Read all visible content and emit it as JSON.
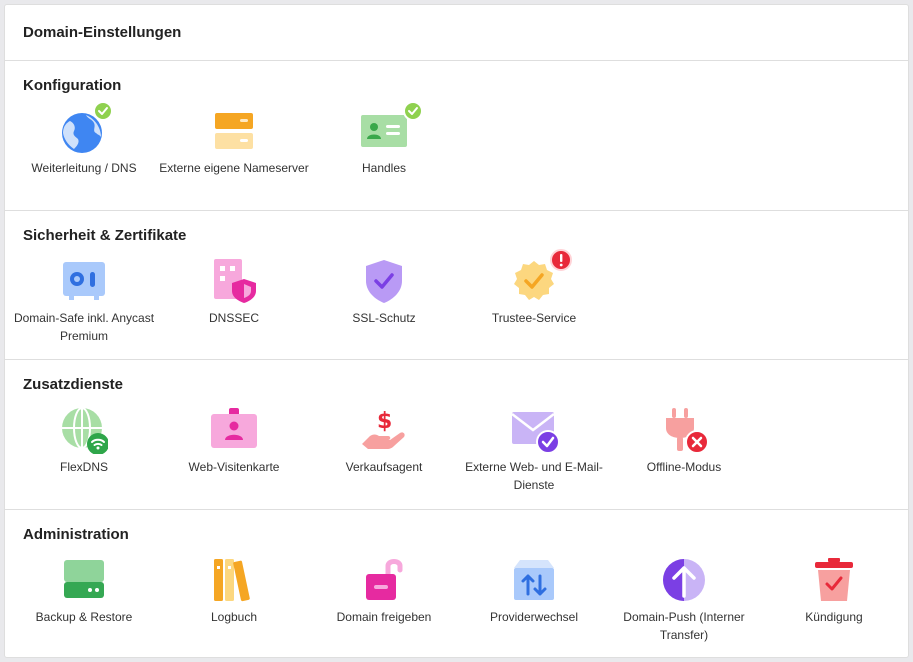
{
  "panel": {
    "title": "Domain-Einstellungen"
  },
  "sections": [
    {
      "title": "Konfiguration",
      "items": [
        {
          "label": "Weiterleitung / DNS",
          "icon": "globe-icon",
          "badge": "check"
        },
        {
          "label": "Externe eigene Nameserver",
          "icon": "server-icon",
          "badge": ""
        },
        {
          "label": "Handles",
          "icon": "contact-card-icon",
          "badge": "check"
        }
      ]
    },
    {
      "title": "Sicherheit & Zertifikate",
      "items": [
        {
          "label": "Domain-Safe inkl. Anycast Premium",
          "icon": "safe-icon",
          "badge": ""
        },
        {
          "label": "DNSSEC",
          "icon": "dnssec-shield-icon",
          "badge": ""
        },
        {
          "label": "SSL-Schutz",
          "icon": "ssl-shield-icon",
          "badge": ""
        },
        {
          "label": "Trustee-Service",
          "icon": "trustee-seal-icon",
          "badge": "warning"
        }
      ]
    },
    {
      "title": "Zusatzdienste",
      "items": [
        {
          "label": "FlexDNS",
          "icon": "flexdns-globe-icon",
          "badge": ""
        },
        {
          "label": "Web-Visitenkarte",
          "icon": "id-badge-icon",
          "badge": ""
        },
        {
          "label": "Verkaufsagent",
          "icon": "money-hand-icon",
          "badge": ""
        },
        {
          "label": "Externe Web- und E-Mail-Dienste",
          "icon": "mail-check-icon",
          "badge": ""
        },
        {
          "label": "Offline-Modus",
          "icon": "plug-off-icon",
          "badge": ""
        }
      ]
    },
    {
      "title": "Administration",
      "items": [
        {
          "label": "Backup & Restore",
          "icon": "backup-drive-icon",
          "badge": ""
        },
        {
          "label": "Logbuch",
          "icon": "logbook-icon",
          "badge": ""
        },
        {
          "label": "Domain freigeben",
          "icon": "unlock-icon",
          "badge": ""
        },
        {
          "label": "Providerwechsel",
          "icon": "provider-switch-icon",
          "badge": ""
        },
        {
          "label": "Domain-Push (Interner Transfer)",
          "icon": "domain-push-icon",
          "badge": ""
        },
        {
          "label": "Kündigung",
          "icon": "trash-icon",
          "badge": ""
        }
      ]
    }
  ],
  "colors": {
    "check_badge": "#8fd14f",
    "warning_badge": "#e8293a",
    "divider": "#dedede"
  }
}
